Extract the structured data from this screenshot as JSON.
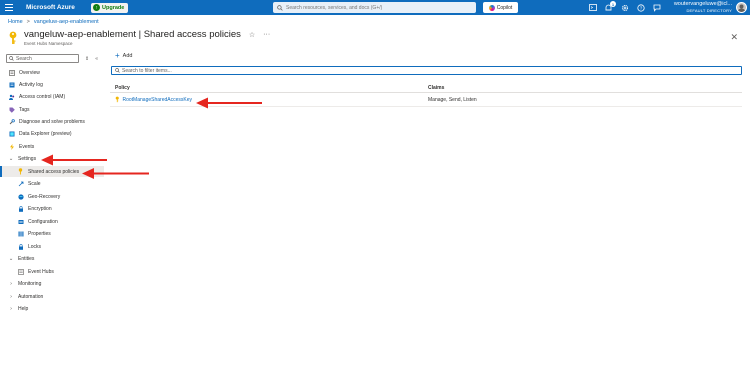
{
  "topbar": {
    "brand": "Microsoft Azure",
    "upgrade_label": "Upgrade",
    "search_placeholder": "Search resources, services, and docs (G+/)",
    "copilot_label": "Copilot",
    "notification_count": "1",
    "account_email": "woutervangeluwe@icl...",
    "account_directory": "DEFAULT DIRECTORY",
    "icons": [
      "menu-icon",
      "cloud-shell-icon",
      "bell-icon",
      "gear-icon",
      "help-icon",
      "feedback-icon"
    ]
  },
  "breadcrumb": {
    "home": "Home",
    "separator": ">",
    "resource": "vangeluw-aep-enablement"
  },
  "header": {
    "resource_name": "vangeluw-aep-enablement",
    "separator": "|",
    "page_title": "Shared access policies",
    "subtitle": "Event Hubs Namespace",
    "star": "☆",
    "more": "···",
    "close": "✕"
  },
  "sidebar": {
    "search_placeholder": "Search",
    "items": [
      {
        "label": "Overview",
        "icon": "overview-icon"
      },
      {
        "label": "Activity log",
        "icon": "activity-log-icon"
      },
      {
        "label": "Access control (IAM)",
        "icon": "iam-icon"
      },
      {
        "label": "Tags",
        "icon": "tag-icon"
      },
      {
        "label": "Diagnose and solve problems",
        "icon": "wrench-icon"
      },
      {
        "label": "Data Explorer (preview)",
        "icon": "data-explorer-icon"
      },
      {
        "label": "Events",
        "icon": "lightning-icon"
      },
      {
        "label": "Settings",
        "icon": "chevron-down-icon"
      },
      {
        "label": "Shared access policies",
        "icon": "key-icon"
      },
      {
        "label": "Scale",
        "icon": "scale-icon"
      },
      {
        "label": "Geo-Recovery",
        "icon": "geo-recovery-icon"
      },
      {
        "label": "Encryption",
        "icon": "lock-icon"
      },
      {
        "label": "Configuration",
        "icon": "configuration-icon"
      },
      {
        "label": "Properties",
        "icon": "properties-icon"
      },
      {
        "label": "Locks",
        "icon": "lock-icon"
      },
      {
        "label": "Entities",
        "icon": "chevron-down-icon"
      },
      {
        "label": "Event Hubs",
        "icon": "event-hubs-icon"
      },
      {
        "label": "Monitoring",
        "icon": "chevron-right-icon"
      },
      {
        "label": "Automation",
        "icon": "chevron-right-icon"
      },
      {
        "label": "Help",
        "icon": "chevron-right-icon"
      }
    ]
  },
  "main": {
    "add_label": "Add",
    "filter_placeholder": "Search to filter items...",
    "columns": [
      "Policy",
      "Claims"
    ],
    "rows": [
      {
        "policy": "RootManageSharedAccessKey",
        "claims": "Manage, Send, Listen"
      }
    ]
  },
  "colors": {
    "accent": "#0f6cbd",
    "arrow": "#e5261f",
    "key": "#f2b705"
  }
}
